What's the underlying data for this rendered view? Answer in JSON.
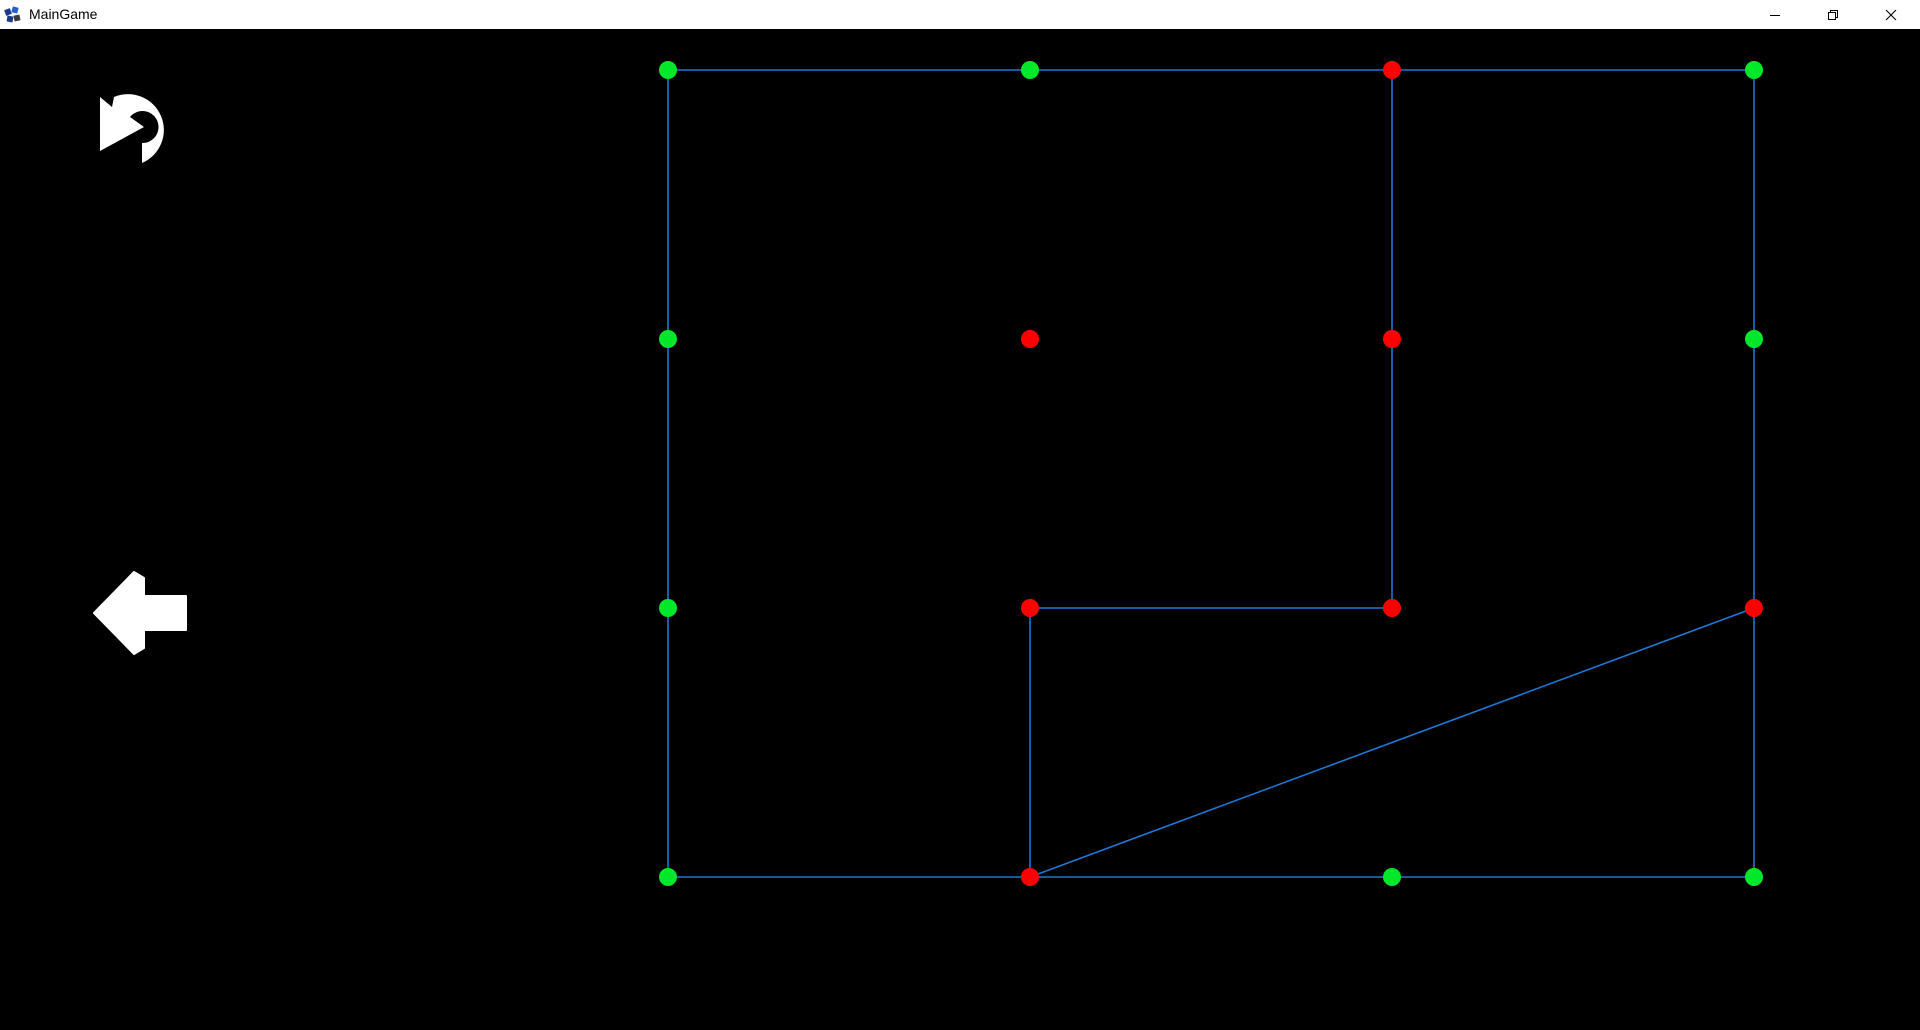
{
  "window": {
    "title": "MainGame",
    "icon": "app-logo-icon",
    "controls": [
      "minimize-icon",
      "restore-icon",
      "close-icon"
    ]
  },
  "toolbar": {
    "undo_icon": "undo-icon",
    "back_icon": "back-arrow-icon",
    "icon_color": "#ffffff"
  },
  "board": {
    "background": "#000000",
    "edge_color": "#1f77d4",
    "colors": {
      "green": "#00e829",
      "red": "#ff0000"
    },
    "grid": {
      "columns": 4,
      "rows": 4
    },
    "nodes": [
      {
        "id": "n-0-0",
        "col": 0,
        "row": 0,
        "state": "green"
      },
      {
        "id": "n-1-0",
        "col": 1,
        "row": 0,
        "state": "green"
      },
      {
        "id": "n-2-0",
        "col": 2,
        "row": 0,
        "state": "red"
      },
      {
        "id": "n-3-0",
        "col": 3,
        "row": 0,
        "state": "green"
      },
      {
        "id": "n-0-1",
        "col": 0,
        "row": 1,
        "state": "green"
      },
      {
        "id": "n-1-1",
        "col": 1,
        "row": 1,
        "state": "red"
      },
      {
        "id": "n-2-1",
        "col": 2,
        "row": 1,
        "state": "red"
      },
      {
        "id": "n-3-1",
        "col": 3,
        "row": 1,
        "state": "green"
      },
      {
        "id": "n-0-2",
        "col": 0,
        "row": 2,
        "state": "green"
      },
      {
        "id": "n-1-2",
        "col": 1,
        "row": 2,
        "state": "red"
      },
      {
        "id": "n-2-2",
        "col": 2,
        "row": 2,
        "state": "red"
      },
      {
        "id": "n-3-2",
        "col": 3,
        "row": 2,
        "state": "red"
      },
      {
        "id": "n-0-3",
        "col": 0,
        "row": 3,
        "state": "green"
      },
      {
        "id": "n-1-3",
        "col": 1,
        "row": 3,
        "state": "red"
      },
      {
        "id": "n-2-3",
        "col": 2,
        "row": 3,
        "state": "green"
      },
      {
        "id": "n-3-3",
        "col": 3,
        "row": 3,
        "state": "green"
      }
    ],
    "edges": [
      [
        "n-0-0",
        "n-3-0"
      ],
      [
        "n-0-0",
        "n-0-3"
      ],
      [
        "n-3-0",
        "n-3-3"
      ],
      [
        "n-0-3",
        "n-3-3"
      ],
      [
        "n-2-0",
        "n-2-2"
      ],
      [
        "n-1-2",
        "n-2-2"
      ],
      [
        "n-1-2",
        "n-1-3"
      ],
      [
        "n-1-3",
        "n-3-2"
      ]
    ]
  }
}
